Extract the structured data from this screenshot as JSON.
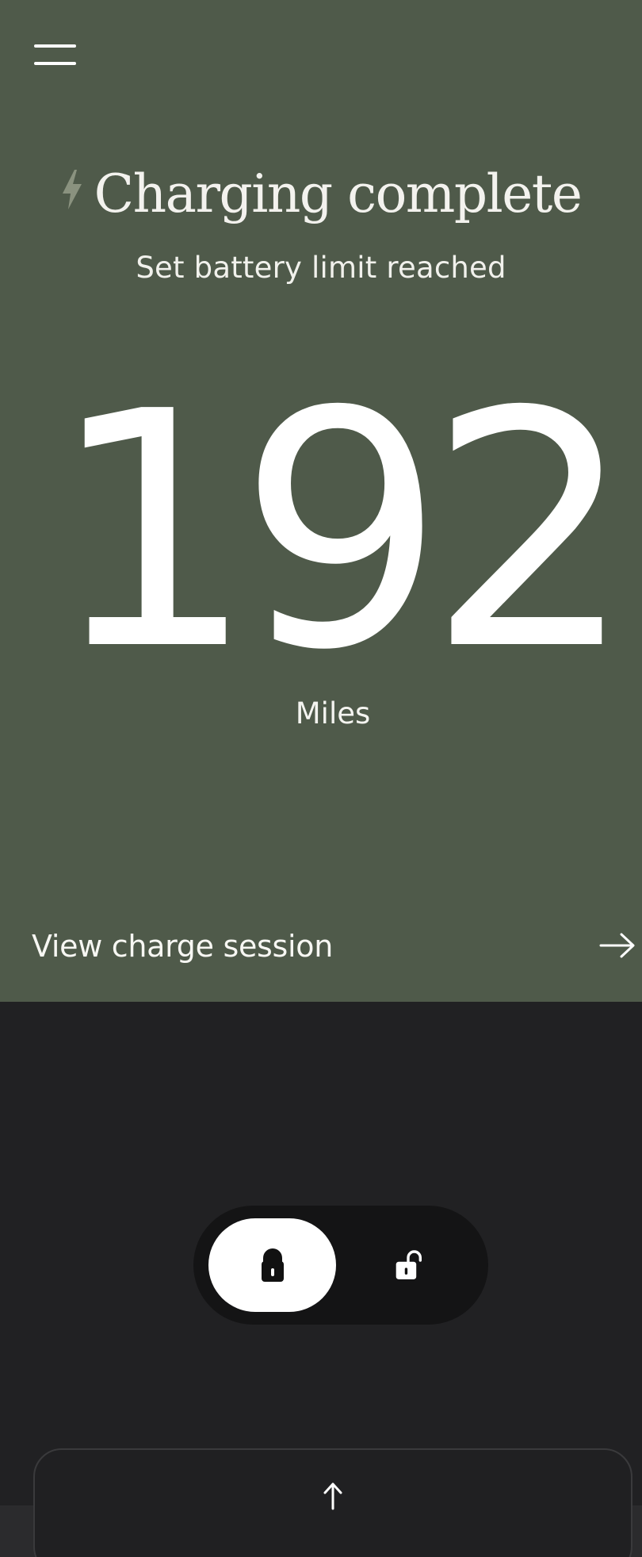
{
  "header": {
    "menu_icon": "hamburger-menu-icon"
  },
  "charging": {
    "status_icon": "lightning-bolt-icon",
    "title": "Charging complete",
    "subtitle": "Set battery limit reached",
    "range_value": "192",
    "range_unit": "Miles"
  },
  "session_link": {
    "label": "View charge session",
    "icon": "arrow-right-icon"
  },
  "lock_toggle": {
    "selected": "locked",
    "options": [
      {
        "id": "locked",
        "icon": "lock-icon"
      },
      {
        "id": "unlocked",
        "icon": "unlock-icon"
      }
    ]
  },
  "drawer": {
    "icon": "arrow-up-icon"
  },
  "colors": {
    "hero_background": "#4f5a4a",
    "app_background": "#212123",
    "toggle_track": "#141415",
    "toggle_thumb": "#ffffff",
    "bolt_accent": "#8a927f"
  }
}
